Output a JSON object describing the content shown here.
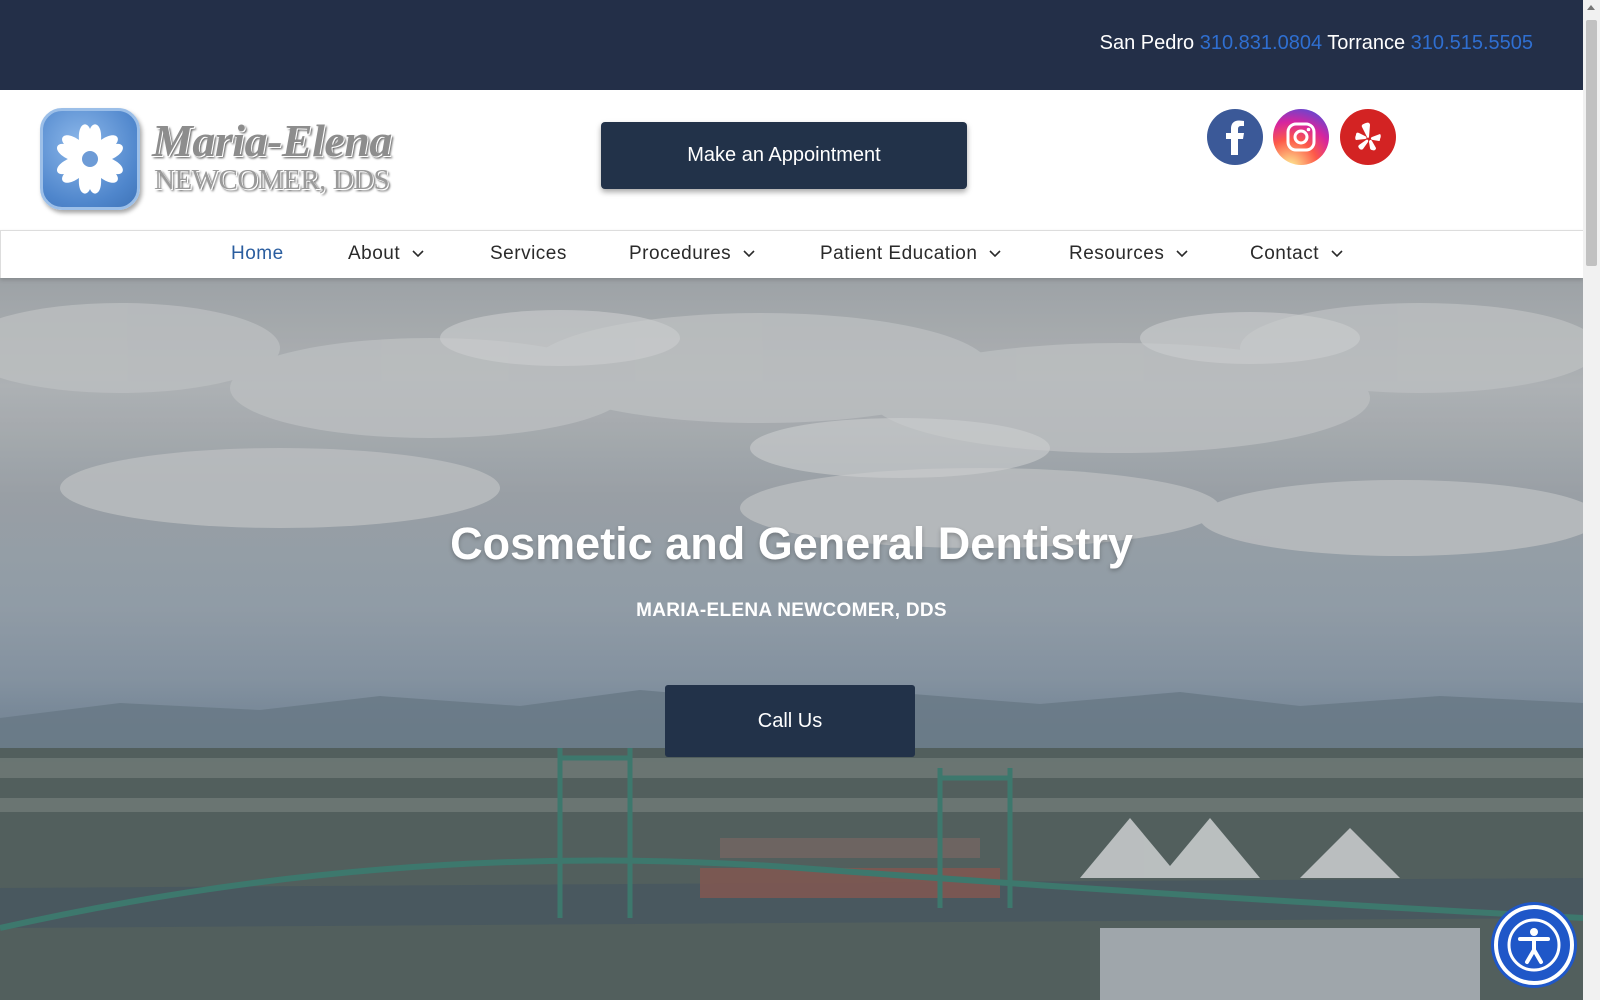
{
  "topbar": {
    "loc1_label": "San Pedro",
    "loc1_phone": "310.831.0804",
    "loc2_label": "Torrance",
    "loc2_phone": "310.515.5505"
  },
  "logo": {
    "line1": "Maria-Elena",
    "line2": "NEWCOMER, DDS"
  },
  "header": {
    "appointment_label": "Make an Appointment",
    "social": [
      "facebook-icon",
      "instagram-icon",
      "yelp-icon"
    ]
  },
  "nav": {
    "items": [
      {
        "label": "Home",
        "active": true,
        "dropdown": false
      },
      {
        "label": "About",
        "active": false,
        "dropdown": true
      },
      {
        "label": "Services",
        "active": false,
        "dropdown": false
      },
      {
        "label": "Procedures",
        "active": false,
        "dropdown": true
      },
      {
        "label": "Patient Education",
        "active": false,
        "dropdown": true
      },
      {
        "label": "Resources",
        "active": false,
        "dropdown": true
      },
      {
        "label": "Contact",
        "active": false,
        "dropdown": true
      }
    ]
  },
  "hero": {
    "title": "Cosmetic and General Dentistry",
    "subtitle": "MARIA-ELENA NEWCOMER, DDS",
    "cta_label": "Call Us"
  },
  "colors": {
    "topbar_bg": "#232f48",
    "button_bg": "#223249",
    "phone_link": "#2f6fd1",
    "nav_active": "#2a5d9f",
    "a11y_blue": "#1f57c8"
  }
}
